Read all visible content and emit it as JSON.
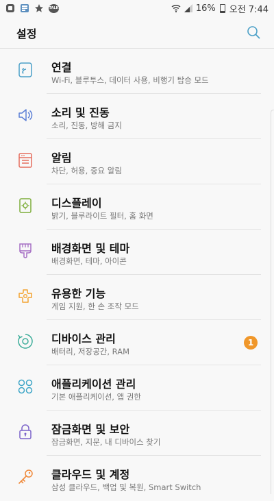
{
  "status_bar": {
    "battery_percent": "16%",
    "time": "오전 7:44",
    "talk_label": "TALK",
    "icons": [
      "app-notification-icon",
      "app-grid-icon",
      "star-icon",
      "talk-icon",
      "wifi-icon",
      "signal-icon",
      "battery-icon"
    ]
  },
  "header": {
    "title": "설정",
    "search_icon": "search-icon"
  },
  "colors": {
    "accent": "#4a9fc7",
    "badge": "#f0972a",
    "connections": "#4a9fc7",
    "sound": "#5b7fd6",
    "notifications": "#e56d5e",
    "display": "#7dae3a",
    "wallpaper": "#a66fc4",
    "advanced": "#f3a331",
    "device": "#3fae9b",
    "apps": "#3fa6c7",
    "lock": "#7a62c9",
    "cloud": "#f08a3c"
  },
  "settings_items": [
    {
      "title": "연결",
      "subtitle": "Wi-Fi, 블루투스, 데이터 사용, 비행기 탑승 모드",
      "icon": "connections-icon"
    },
    {
      "title": "소리 및 진동",
      "subtitle": "소리, 진동, 방해 금지",
      "icon": "speaker-icon"
    },
    {
      "title": "알림",
      "subtitle": "차단, 허용, 중요 알림",
      "icon": "notification-icon"
    },
    {
      "title": "디스플레이",
      "subtitle": "밝기, 블루라이트 필터, 홈 화면",
      "icon": "display-icon"
    },
    {
      "title": "배경화면 및 테마",
      "subtitle": "배경화면, 테마, 아이콘",
      "icon": "brush-icon"
    },
    {
      "title": "유용한 기능",
      "subtitle": "게임 지원, 한 손 조작 모드",
      "icon": "puzzle-icon"
    },
    {
      "title": "디바이스 관리",
      "subtitle": "배터리, 저장공간, RAM",
      "icon": "device-maintenance-icon",
      "badge": "1"
    },
    {
      "title": "애플리케이션 관리",
      "subtitle": "기본 애플리케이션, 앱 권한",
      "icon": "apps-icon"
    },
    {
      "title": "잠금화면 및 보안",
      "subtitle": "잠금화면, 지문, 내 디바이스 찾기",
      "icon": "lock-icon"
    },
    {
      "title": "클라우드 및 계정",
      "subtitle": "삼성 클라우드, 백업 및 복원, Smart Switch",
      "icon": "key-icon"
    }
  ]
}
